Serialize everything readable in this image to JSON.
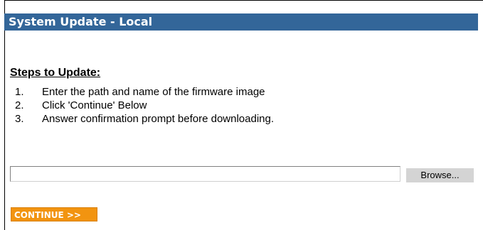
{
  "header": {
    "title": "System Update - Local"
  },
  "instructions": {
    "heading": "Steps to Update:",
    "steps": [
      {
        "number": "1.",
        "text": "Enter the path and name of the firmware image"
      },
      {
        "number": "2.",
        "text": "Click 'Continue' Below"
      },
      {
        "number": "3.",
        "text": "Answer confirmation prompt before downloading."
      }
    ]
  },
  "file_picker": {
    "value": "",
    "browse_label": "Browse..."
  },
  "actions": {
    "continue_label": "CONTINUE >>"
  },
  "colors": {
    "title_bar": "#336699",
    "continue_button": "#f29410"
  }
}
